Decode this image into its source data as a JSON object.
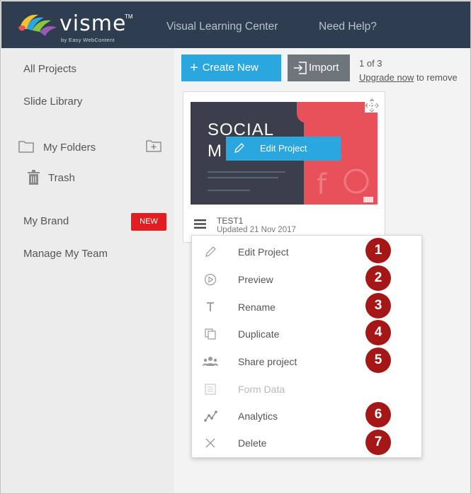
{
  "colors": {
    "header_bg": "#2f3d50",
    "accent": "#2aa7de",
    "badge_red": "#e11d22",
    "callout_red": "#a51717"
  },
  "header": {
    "logo_text": "visme",
    "logo_tm": "TM",
    "logo_sub": "by Easy WebContent",
    "nav": [
      "Visual Learning Center",
      "Need Help?"
    ]
  },
  "sidebar": {
    "all_projects": "All Projects",
    "slide_library": "Slide Library",
    "my_folders": "My Folders",
    "trash": "Trash",
    "my_brand": "My Brand",
    "new_badge": "NEW",
    "manage_team": "Manage My Team"
  },
  "toolbar": {
    "create_label": "Create New",
    "create_icon": "+",
    "import_label": "Import",
    "page_count": "1 of 3",
    "upgrade_link": "Upgrade now",
    "upgrade_rest": " to remove"
  },
  "project": {
    "thumb_title_1": "SOCIAL",
    "thumb_title_2": "M",
    "edit_overlay": "Edit Project",
    "name": "TEST1",
    "updated": "Updated 21 Nov 2017"
  },
  "menu": [
    {
      "label": "Edit Project",
      "icon": "pencil-icon",
      "callout": "1",
      "enabled": true
    },
    {
      "label": "Preview",
      "icon": "play-icon",
      "callout": "2",
      "enabled": true
    },
    {
      "label": "Rename",
      "icon": "text-icon",
      "callout": "3",
      "enabled": true
    },
    {
      "label": "Duplicate",
      "icon": "duplicate-icon",
      "callout": "4",
      "enabled": true
    },
    {
      "label": "Share project",
      "icon": "people-icon",
      "callout": "5",
      "enabled": true
    },
    {
      "label": "Form Data",
      "icon": "form-icon",
      "callout": "",
      "enabled": false
    },
    {
      "label": "Analytics",
      "icon": "analytics-icon",
      "callout": "6",
      "enabled": true
    },
    {
      "label": "Delete",
      "icon": "delete-icon",
      "callout": "7",
      "enabled": true
    }
  ]
}
